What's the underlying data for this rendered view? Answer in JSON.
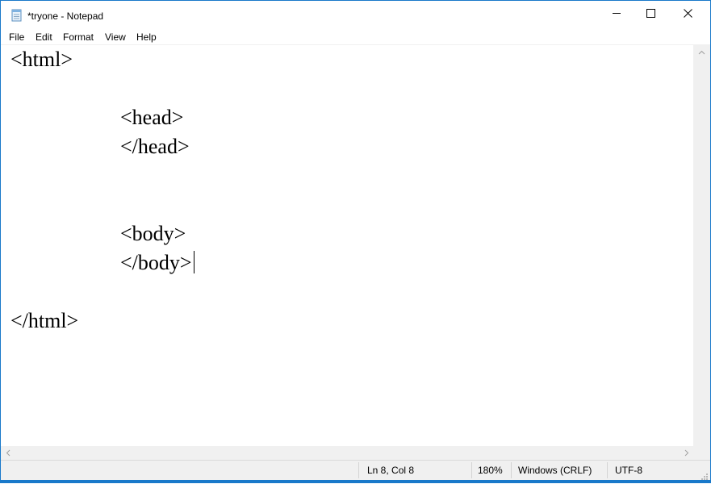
{
  "window": {
    "title": "*tryone - Notepad",
    "app_icon": "notepad-icon",
    "controls": {
      "minimize_icon": "minimize-icon",
      "maximize_icon": "maximize-icon",
      "close_icon": "close-icon"
    }
  },
  "menu": {
    "items": [
      {
        "label": "File"
      },
      {
        "label": "Edit"
      },
      {
        "label": "Format"
      },
      {
        "label": "View"
      },
      {
        "label": "Help"
      }
    ]
  },
  "editor": {
    "lines": [
      "<html>",
      "",
      "\t<head>",
      "\t</head>",
      "",
      "",
      "\t<body>",
      "\t</body>",
      "",
      "</html>"
    ],
    "display": {
      "line_1": "<html>",
      "line_3": "<head>",
      "line_4": "</head>",
      "line_7": "<body>",
      "line_8": "</body>",
      "line_10": "</html>"
    }
  },
  "status": {
    "position": "Ln 8, Col 8",
    "zoom": "180%",
    "line_ending": "Windows (CRLF)",
    "encoding": "UTF-8"
  },
  "colors": {
    "window_border": "#1979ca",
    "chrome_background": "#f0f0f0",
    "text": "#000000"
  }
}
